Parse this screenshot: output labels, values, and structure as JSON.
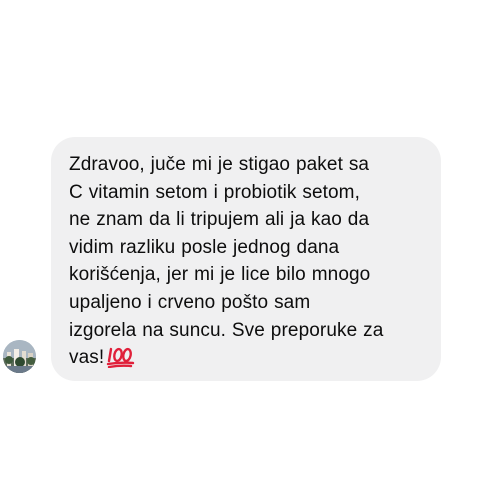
{
  "conversation": {
    "message": {
      "lines": [
        "Zdravoo, juče mi je stigao paket sa",
        "C vitamin setom i probiotik setom,",
        "ne znam da li tripujem ali ja kao da",
        "vidim razliku posle jednog dana",
        "korišćenja, jer mi je lice bilo mnogo",
        "upaljeno i crveno pošto sam",
        "izgorela na suncu. Sve preporuke za",
        "vas!"
      ],
      "emoji": "hundred-points-emoji",
      "bubble_color": "#f0f0f1",
      "text_color": "#0d0d0d"
    },
    "sender": {
      "avatar": "avatar-photo"
    }
  }
}
